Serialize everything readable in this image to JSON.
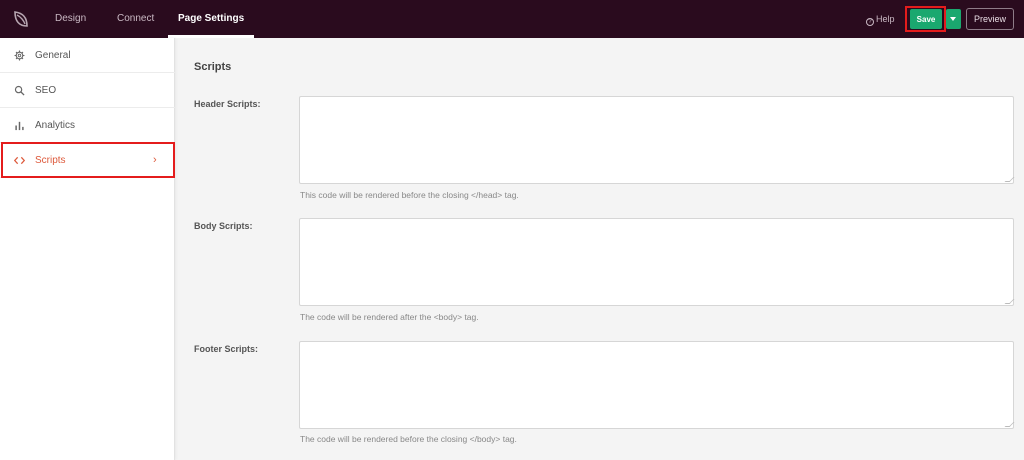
{
  "topbar": {
    "tabs": [
      {
        "label": "Design"
      },
      {
        "label": "Connect"
      },
      {
        "label": "Page Settings"
      }
    ],
    "help_label": "Help",
    "save_label": "Save",
    "preview_label": "Preview",
    "accent_color": "#1aa86f",
    "background_color": "#2a0b1e"
  },
  "sidebar": {
    "items": [
      {
        "label": "General",
        "icon": "gear-icon"
      },
      {
        "label": "SEO",
        "icon": "search-icon"
      },
      {
        "label": "Analytics",
        "icon": "bar-chart-icon"
      },
      {
        "label": "Scripts",
        "icon": "code-icon",
        "active": true
      }
    ],
    "active_color": "#dd5a3c"
  },
  "main": {
    "title": "Scripts",
    "fields": [
      {
        "label": "Header Scripts:",
        "value": "",
        "help": "This code will be rendered before the closing </head> tag."
      },
      {
        "label": "Body Scripts:",
        "value": "",
        "help": "The code will be rendered after the <body> tag."
      },
      {
        "label": "Footer Scripts:",
        "value": "",
        "help": "The code will be rendered before the closing </body> tag."
      }
    ]
  }
}
